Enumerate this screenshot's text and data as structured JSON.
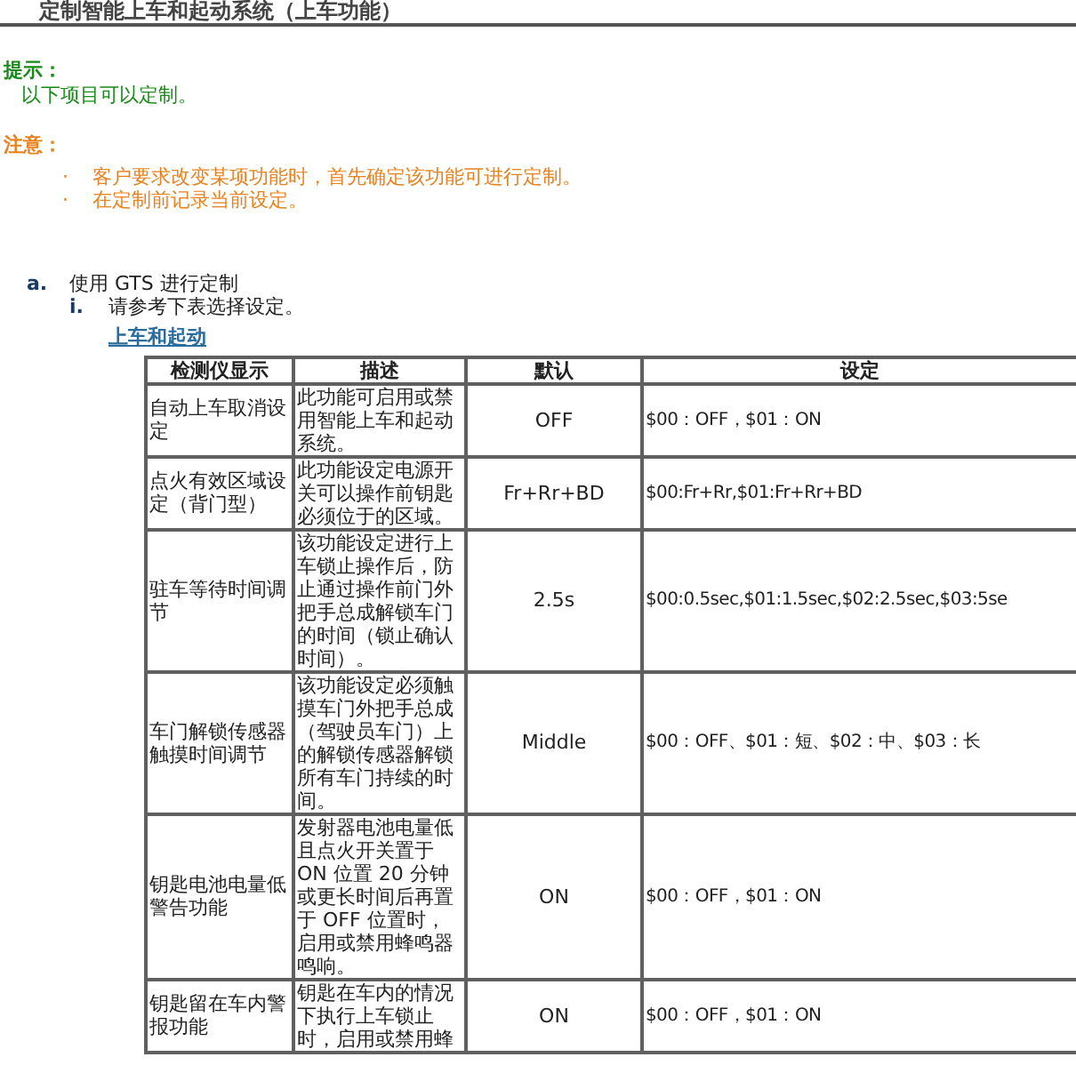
{
  "title": "定制智能上车和起动系统（上车功能）",
  "hint": {
    "label": "提示：",
    "text": "以下项目可以定制。"
  },
  "caution": {
    "label": "注意：",
    "items": [
      {
        "marker": "·",
        "text": "客户要求改变某项功能时，首先确定该功能可进行定制。"
      },
      {
        "marker": "·",
        "text": "在定制前记录当前设定。"
      }
    ]
  },
  "steps": [
    {
      "marker": "a.",
      "text": "使用 GTS 进行定制",
      "substeps": [
        {
          "marker": "i.",
          "text": "请参考下表选择设定。",
          "table_title": "上车和起动",
          "table": {
            "columns": [
              "检测仪显示",
              "描述",
              "默认",
              "设定"
            ],
            "rows": [
              [
                "自动上车取消设定",
                "此功能可启用或禁用智能上车和起动系统。",
                "OFF",
                "$00：OFF，$01：ON"
              ],
              [
                "点火有效区域设定（背门型）",
                "此功能设定电源开关可以操作前钥匙必须位于的区域。",
                "Fr+Rr+BD",
                "$00:Fr+Rr,$01:Fr+Rr+BD"
              ],
              [
                "驻车等待时间调节",
                "该功能设定进行上车锁止操作后，防止通过操作前门外把手总成解锁车门的时间（锁止确认时间）。",
                "2.5s",
                "$00:0.5sec,$01:1.5sec,$02:2.5sec,$03:5se"
              ],
              [
                "车门解锁传感器触摸时间调节",
                "该功能设定必须触摸车门外把手总成（驾驶员车门）上的解锁传感器解锁所有车门持续的时间。",
                "Middle",
                "$00：OFF、$01：短、$02：中、$03：长"
              ],
              [
                "钥匙电池电量低警告功能",
                "发射器电池电量低且点火开关置于 ON 位置 20 分钟或更长时间后再置于 OFF 位置时，启用或禁用蜂鸣器鸣响。",
                "ON",
                "$00：OFF，$01：ON"
              ],
              [
                "钥匙留在车内警报功能",
                "钥匙在车内的情况下执行上车锁止时，启用或禁用蜂",
                "ON",
                "$00：OFF，$01：ON"
              ]
            ]
          }
        }
      ]
    }
  ]
}
